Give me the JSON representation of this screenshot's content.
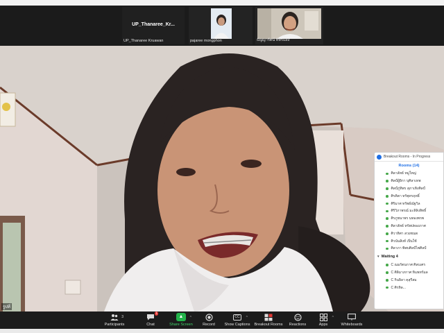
{
  "gallery": {
    "tiles": [
      {
        "center_name": "UP_Thanaree_Kr...",
        "name": "UP_Thanaree Kruawan"
      },
      {
        "name": "pajaree mongphon"
      },
      {
        "name": "ธัญญารัตน์ ทิพรแสง"
      }
    ]
  },
  "main_video": {
    "corner_label": "รูปที่"
  },
  "breakout_panel": {
    "header": "Breakout Rooms - In Progress",
    "rooms_label": "Rooms (14)",
    "participants": [
      "ศิลาลัทธ์ หมู่ใหญ่",
      "ศิลป์ผู้ยิกา บุศิลาเทพ",
      "ศิลป์ภู่ทิพร สุภาเทิงศิลป์",
      "ศิรคิตา ทรัพุทรฤทธิ์",
      "ศิริมาศ ทรัพย์ณัฐวิล",
      "ศิริวิภาพรณ์ มะลิลิงสิทธิ์",
      "ศิรภูชนาพร นทองพรพ",
      "ศิลาลัทธ์ ทรัพปทองภาศ",
      "ศิวาทิศา สวยชนพ",
      "ศิวนันสิงห์ เปิ่นใช้",
      "ศิลาภา พิพบศิลป์ไพศิลป์"
    ],
    "waiting_label": "Waiting 4",
    "waiting": [
      "C ณมรัตนกาศ ศิลบเศร",
      "C ศิลิมาภกาศ ทิแพทร์มล",
      "C กินยิลา คุสุรีสม",
      "C ศิรหิล..."
    ]
  },
  "toolbar": {
    "items": [
      {
        "label": "Participants",
        "icon": "participants-icon",
        "count": "3"
      },
      {
        "label": "Chat",
        "icon": "chat-icon",
        "badge": "1"
      },
      {
        "label": "Share Screen",
        "icon": "share-screen-icon"
      },
      {
        "label": "Record",
        "icon": "record-icon"
      },
      {
        "label": "Show Captions",
        "icon": "captions-icon",
        "glyph": "CC"
      },
      {
        "label": "Breakout Rooms",
        "icon": "breakout-rooms-icon"
      },
      {
        "label": "Reactions",
        "icon": "reactions-icon"
      },
      {
        "label": "Apps",
        "icon": "apps-icon"
      },
      {
        "label": "Whiteboards",
        "icon": "whiteboards-icon"
      }
    ]
  },
  "colors": {
    "accent_blue": "#1f6fe5",
    "share_green": "#23b34a",
    "room_dot_green": "#46a84a",
    "badge_red": "#e53935"
  }
}
